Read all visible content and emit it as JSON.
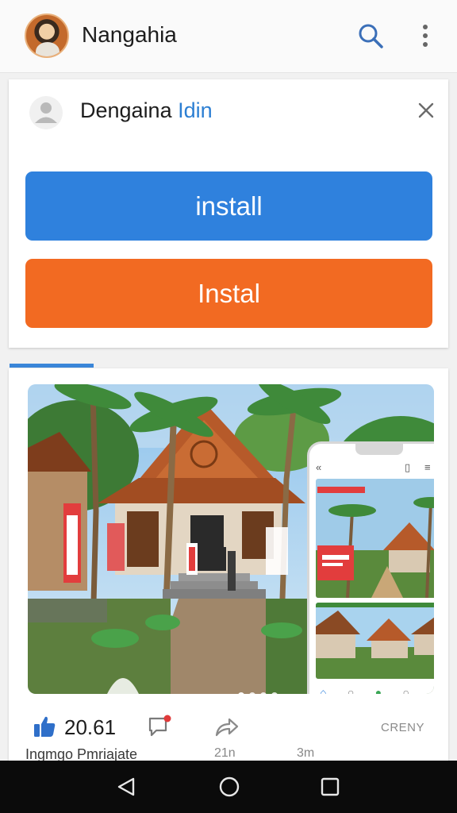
{
  "app_bar": {
    "title": "Nangahia",
    "avatar_icon": "profile-photo",
    "search_icon": "search-icon",
    "more_icon": "more-vertical-icon"
  },
  "install_card": {
    "name_main": "Dengaina",
    "name_accent": " Idin",
    "install_primary_label": "install",
    "install_secondary_label": "Instal",
    "primary_color": "#2f81dd",
    "secondary_color": "#f26a22"
  },
  "post": {
    "like_count": "20.61",
    "more_label": "CRENY",
    "caption": "Ingmgo Pmriajate",
    "meta_1": "21n",
    "meta_2": "3m"
  },
  "colors": {
    "accent": "#2c7fd3",
    "nav_bar": "#0b0b0b"
  }
}
